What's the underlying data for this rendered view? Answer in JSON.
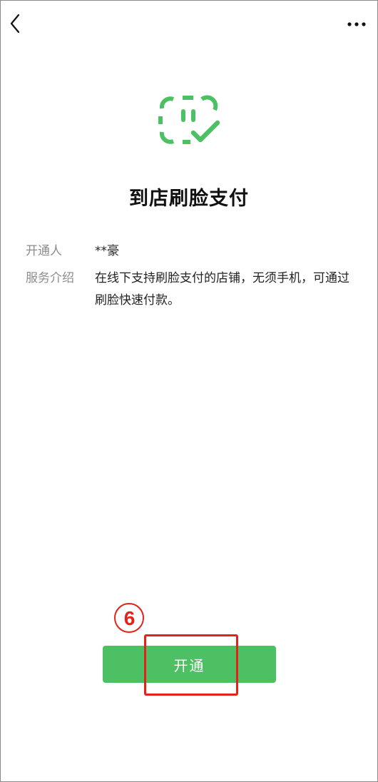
{
  "page": {
    "title": "到店刷脸支付",
    "opener_label": "开通人",
    "opener_value": "**豪",
    "service_label": "服务介绍",
    "service_value": "在线下支持刷脸支付的店铺，无须手机，可通过刷脸快速付款。",
    "open_button_label": "开通"
  },
  "annotation": {
    "step_number": "6"
  },
  "icons": {
    "back": "chevron-left-icon",
    "more": "more-dots-icon",
    "hero": "face-pay-check-icon"
  },
  "colors": {
    "accent_green": "#4cc063",
    "annotation_red": "#e32219",
    "label_gray": "#8c8c8c"
  }
}
